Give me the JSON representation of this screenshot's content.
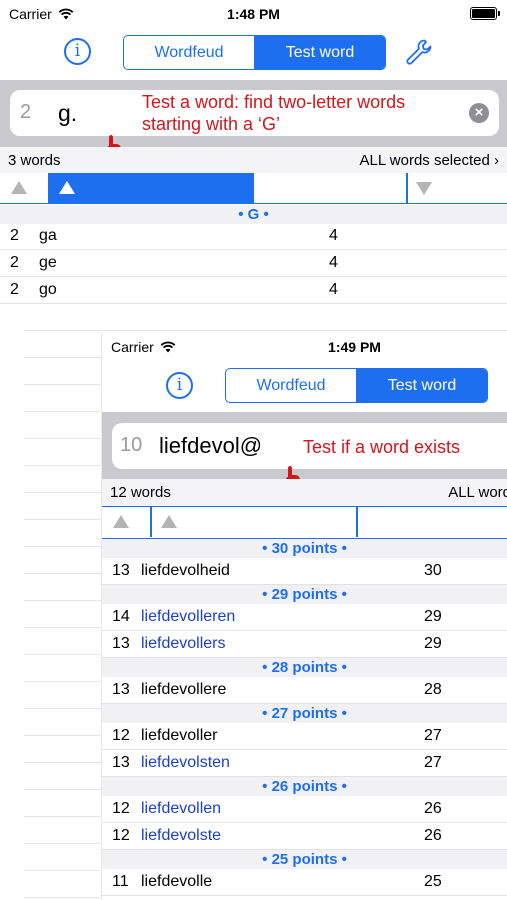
{
  "screen1": {
    "status": {
      "carrier": "Carrier",
      "time": "1:48 PM"
    },
    "nav": {
      "segments": [
        "Wordfeud",
        "Test word"
      ],
      "active_index": 1
    },
    "search": {
      "count": "2",
      "query": "g."
    },
    "annotation": "Test a word: find two-letter words starting with a ‘G’",
    "results": {
      "count_label": "3 words",
      "selection_label": "ALL words selected ›"
    },
    "sections": [
      {
        "label": "• G •",
        "rows": [
          {
            "len": "2",
            "word": "ga",
            "points": "4"
          },
          {
            "len": "2",
            "word": "ge",
            "points": "4"
          },
          {
            "len": "2",
            "word": "go",
            "points": "4"
          }
        ]
      }
    ]
  },
  "screen2": {
    "status": {
      "carrier": "Carrier",
      "time": "1:49 PM"
    },
    "nav": {
      "segments": [
        "Wordfeud",
        "Test word"
      ],
      "active_index": 1
    },
    "search": {
      "count": "10",
      "query": "liefdevol@"
    },
    "annotation": "Test if a word exists",
    "results": {
      "count_label": "12 words",
      "selection_label": "ALL word"
    },
    "sections": [
      {
        "label": "• 30 points •",
        "rows": [
          {
            "len": "13",
            "word": "liefdevolheid",
            "points": "30",
            "blue": false
          }
        ]
      },
      {
        "label": "• 29 points •",
        "rows": [
          {
            "len": "14",
            "word": "liefdevolleren",
            "points": "29",
            "blue": true
          },
          {
            "len": "13",
            "word": "liefdevollers",
            "points": "29",
            "blue": true
          }
        ]
      },
      {
        "label": "• 28 points •",
        "rows": [
          {
            "len": "13",
            "word": "liefdevollere",
            "points": "28",
            "blue": false
          }
        ]
      },
      {
        "label": "• 27 points •",
        "rows": [
          {
            "len": "12",
            "word": "liefdevoller",
            "points": "27",
            "blue": false
          },
          {
            "len": "13",
            "word": "liefdevolsten",
            "points": "27",
            "blue": true
          }
        ]
      },
      {
        "label": "• 26 points •",
        "rows": [
          {
            "len": "12",
            "word": "liefdevollen",
            "points": "26",
            "blue": true
          },
          {
            "len": "12",
            "word": "liefdevolste",
            "points": "26",
            "blue": true
          }
        ]
      },
      {
        "label": "• 25 points •",
        "rows": [
          {
            "len": "11",
            "word": "liefdevolle",
            "points": "25",
            "blue": false
          }
        ]
      }
    ]
  },
  "colors": {
    "accent": "#1e6ff0",
    "annotation": "#d4151c",
    "link_word": "#1a3fd1"
  },
  "icons": [
    "info-icon",
    "wrench-icon",
    "clear-icon",
    "wifi-icon",
    "battery-icon",
    "sort-up-icon",
    "sort-down-icon",
    "pointer-icon"
  ]
}
